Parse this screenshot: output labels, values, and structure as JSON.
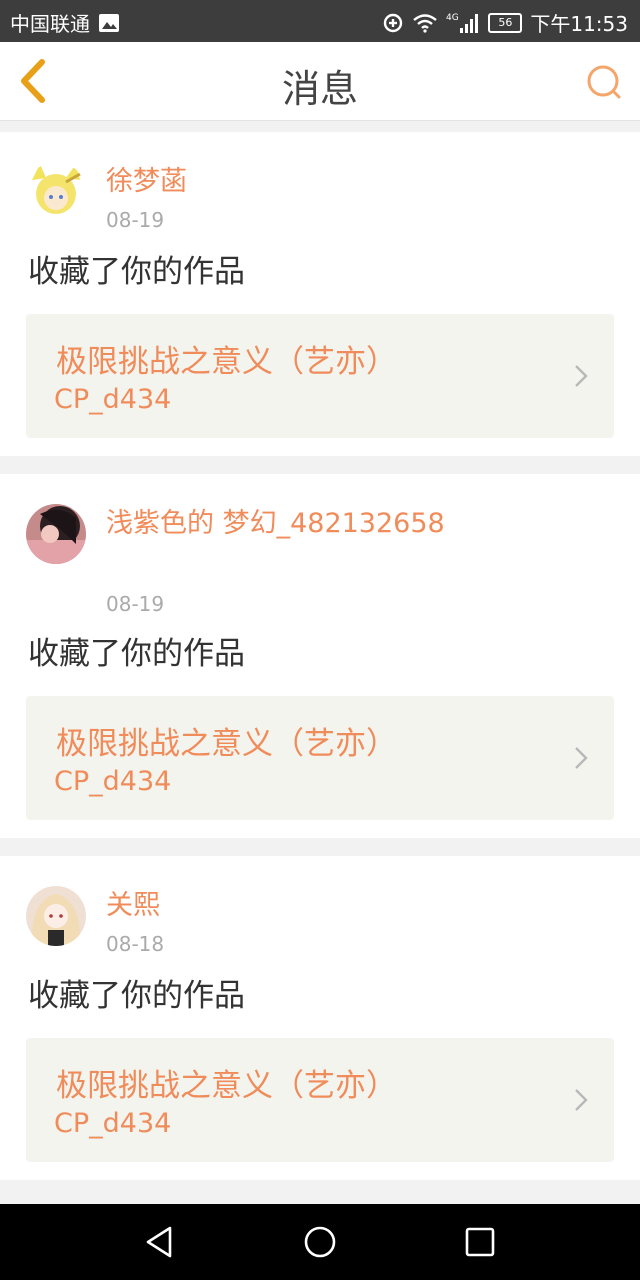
{
  "status_bar": {
    "carrier": "中国联通",
    "time": "下午11:53",
    "battery": "56",
    "network": "4G",
    "icons": [
      "image-icon",
      "alarm-icon",
      "wifi-icon",
      "signal-icon",
      "battery-icon"
    ]
  },
  "header": {
    "title": "消息",
    "back_icon": "chevron-left-icon",
    "search_icon": "search-icon"
  },
  "colors": {
    "accent": "#f08b5a",
    "back_icon": "#e8a019",
    "search_icon": "#f4a66a",
    "link_bg": "#f4f4ef"
  },
  "messages": [
    {
      "user_name": "徐梦菡",
      "date": "08-19",
      "action": "收藏了你的作品",
      "work_title": "极限挑战之意义（艺亦）",
      "work_code": "CP_d434"
    },
    {
      "user_name": "浅紫色的 梦幻_482132658",
      "date": "08-19",
      "action": "收藏了你的作品",
      "work_title": "极限挑战之意义（艺亦）",
      "work_code": "CP_d434"
    },
    {
      "user_name": "关熙",
      "date": "08-18",
      "action": "收藏了你的作品",
      "work_title": "极限挑战之意义（艺亦）",
      "work_code": "CP_d434"
    }
  ],
  "nav_bar": {
    "icons": [
      "back-triangle-icon",
      "home-circle-icon",
      "recents-square-icon"
    ]
  }
}
